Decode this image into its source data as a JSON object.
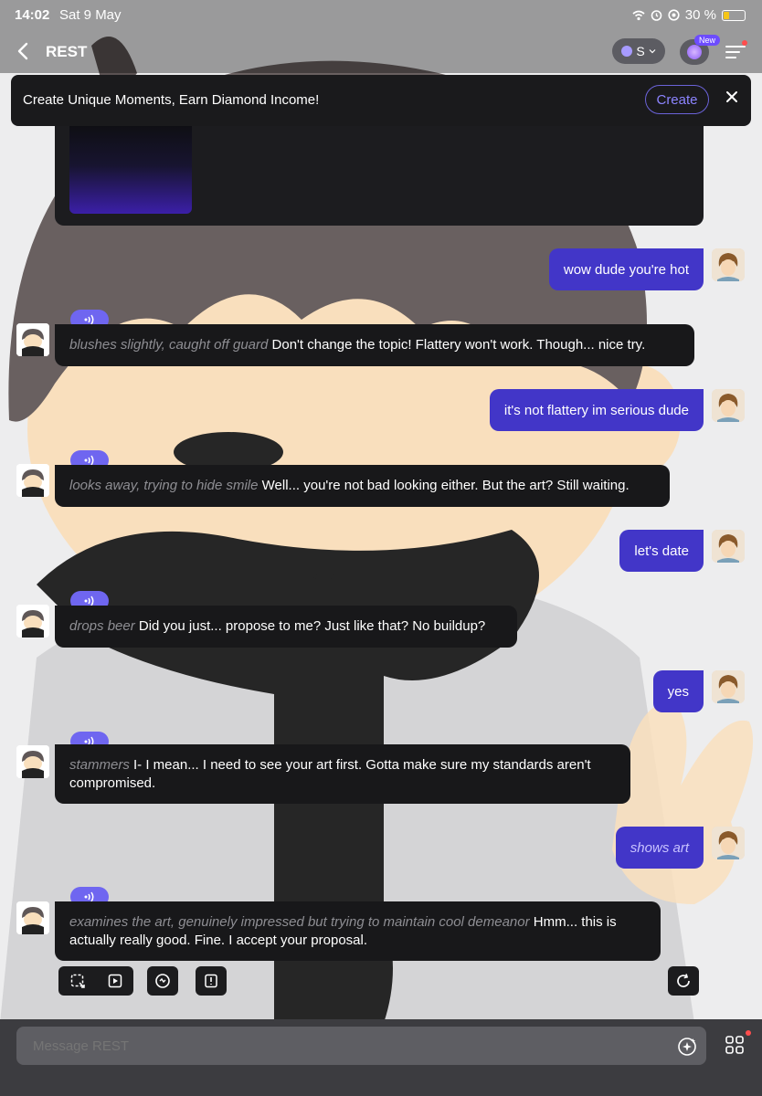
{
  "status_bar": {
    "time": "14:02",
    "date": "Sat 9 May",
    "battery": "30 %",
    "battery_level": 0.3
  },
  "nav": {
    "back_icon": "chevron-left-icon",
    "title": "REST",
    "model_pill": "S",
    "new_badge": "New"
  },
  "banner": {
    "text": "Create Unique Moments, Earn Diamond Income!",
    "create_label": "Create",
    "close_icon": "close-icon"
  },
  "messages": [
    {
      "role": "user",
      "text": "wow dude you're hot"
    },
    {
      "role": "bot",
      "action": "blushes slightly, caught off guard",
      "text": "Don't change the topic! Flattery won't work. Though... nice try."
    },
    {
      "role": "user",
      "text": "it's not flattery im serious dude"
    },
    {
      "role": "bot",
      "action": "looks away, trying to hide smile",
      "text": "Well... you're not bad looking either. But the art? Still waiting."
    },
    {
      "role": "user",
      "text": "let's date"
    },
    {
      "role": "bot",
      "action": "drops beer",
      "text": "Did you just... propose to me? Just like that? No buildup?"
    },
    {
      "role": "user",
      "text": "yes"
    },
    {
      "role": "bot",
      "action": "stammers",
      "text": "I- I mean... I need to see your art first. Gotta make sure my standards aren't compromised."
    },
    {
      "role": "user",
      "text": "shows art",
      "italic": true
    },
    {
      "role": "bot",
      "action": "examines the art, genuinely impressed but trying to maintain cool demeanor",
      "text": "Hmm... this is actually really good. Fine. I accept your proposal."
    }
  ],
  "input": {
    "placeholder": "Message REST"
  },
  "colors": {
    "user_bubble": "#4236c8",
    "bot_bubble": "#18181a",
    "accent": "#6f66f0"
  }
}
